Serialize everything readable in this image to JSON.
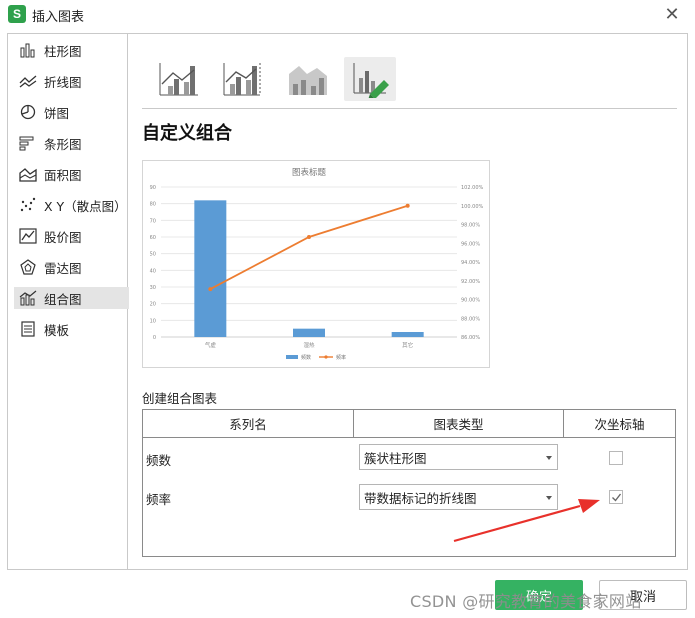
{
  "window": {
    "title": "插入图表",
    "app_icon_letter": "S"
  },
  "sidebar": {
    "items": [
      {
        "label": "柱形图",
        "icon": "bar-chart-icon",
        "active": false
      },
      {
        "label": "折线图",
        "icon": "line-chart-icon",
        "active": false
      },
      {
        "label": "饼图",
        "icon": "pie-chart-icon",
        "active": false
      },
      {
        "label": "条形图",
        "icon": "horizontal-bar-chart-icon",
        "active": false
      },
      {
        "label": "面积图",
        "icon": "area-chart-icon",
        "active": false
      },
      {
        "label": "X Y（散点图）",
        "icon": "scatter-chart-icon",
        "active": false
      },
      {
        "label": "股价图",
        "icon": "stock-chart-icon",
        "active": false
      },
      {
        "label": "雷达图",
        "icon": "radar-chart-icon",
        "active": false
      },
      {
        "label": "组合图",
        "icon": "combo-chart-icon",
        "active": true
      },
      {
        "label": "模板",
        "icon": "template-icon",
        "active": false
      }
    ]
  },
  "chart_types": {
    "options": [
      {
        "icon": "combo-clustered-column-line-icon",
        "selected": false
      },
      {
        "icon": "combo-column-line-secondary-axis-icon",
        "selected": false
      },
      {
        "icon": "combo-area-column-icon",
        "selected": false
      },
      {
        "icon": "custom-combo-icon",
        "selected": true
      }
    ]
  },
  "heading": "自定义组合",
  "chart_data": {
    "type": "bar",
    "title": "图表标题",
    "categories": [
      "气虚",
      "湿热",
      "其它"
    ],
    "series": [
      {
        "name": "频数",
        "type": "bar",
        "axis": "primary",
        "values": [
          82,
          5,
          3
        ],
        "color": "#5b9bd5"
      },
      {
        "name": "频率",
        "type": "line",
        "axis": "secondary",
        "values": [
          0.9111,
          0.9667,
          1.0
        ],
        "color": "#ed7d31"
      }
    ],
    "y_ticks": [
      "0",
      "10",
      "20",
      "30",
      "40",
      "50",
      "60",
      "70",
      "80",
      "90"
    ],
    "ylim": [
      0,
      90
    ],
    "y2_ticks": [
      "86.00%",
      "88.00%",
      "90.00%",
      "92.00%",
      "94.00%",
      "96.00%",
      "98.00%",
      "100.00%",
      "102.00%"
    ],
    "y2lim": [
      0.86,
      1.02
    ],
    "legend": "bottom",
    "grid": true
  },
  "combo_section": {
    "label": "创建组合图表",
    "headers": {
      "series_name": "系列名",
      "chart_type": "图表类型",
      "secondary_axis": "次坐标轴"
    },
    "rows": [
      {
        "name": "频数",
        "chart_type": "簇状柱形图",
        "secondary_axis": false
      },
      {
        "name": "频率",
        "chart_type": "带数据标记的折线图",
        "secondary_axis": true
      }
    ]
  },
  "buttons": {
    "ok": "确定",
    "cancel": "取消"
  },
  "watermark": "CSDN @研究教育的美食家网站",
  "colors": {
    "accent_green": "#35b262",
    "arrow_red": "#e8312b",
    "bar_blue": "#5b9bd5",
    "line_orange": "#ed7d31"
  }
}
